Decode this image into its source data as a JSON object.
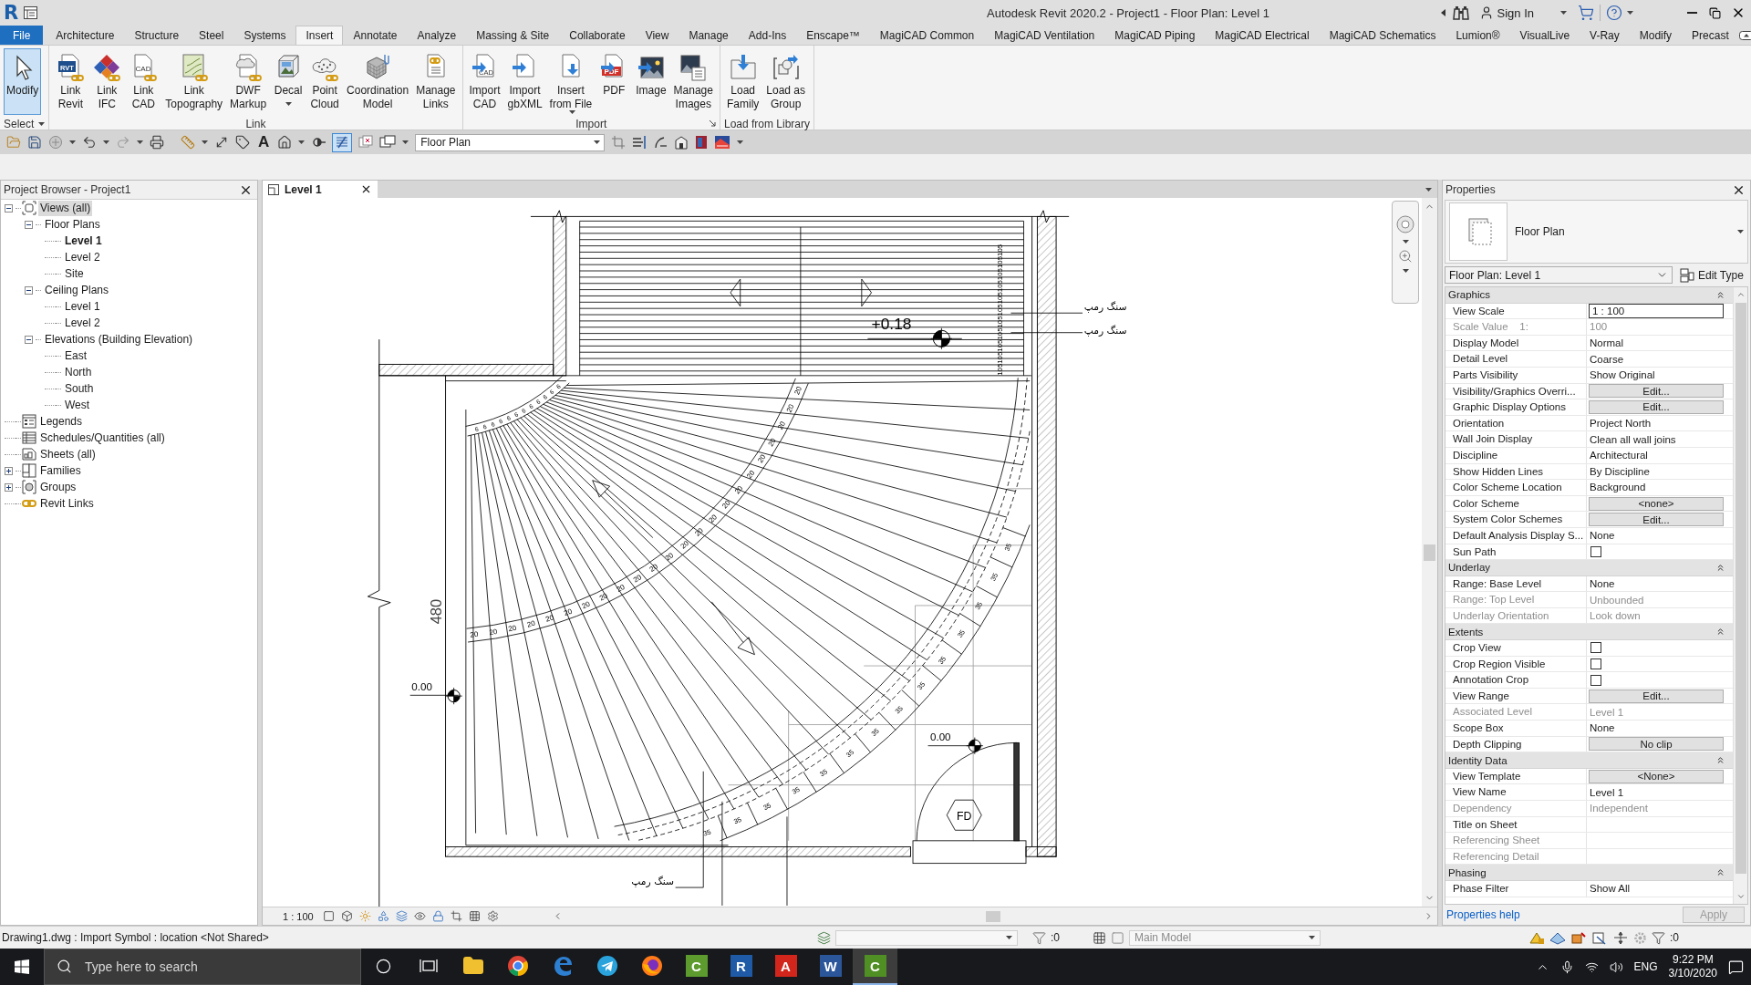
{
  "window": {
    "logo": "R",
    "title": "Autodesk Revit 2020.2 - Project1 - Floor Plan: Level 1",
    "sign_in": "Sign In"
  },
  "ribbon_tabs": [
    {
      "label": "File",
      "kind": "file",
      "selected": false
    },
    {
      "label": "Architecture",
      "kind": "tab",
      "selected": false
    },
    {
      "label": "Structure",
      "kind": "tab",
      "selected": false
    },
    {
      "label": "Steel",
      "kind": "tab",
      "selected": false
    },
    {
      "label": "Systems",
      "kind": "tab",
      "selected": false
    },
    {
      "label": "Insert",
      "kind": "tab",
      "selected": true
    },
    {
      "label": "Annotate",
      "kind": "tab",
      "selected": false
    },
    {
      "label": "Analyze",
      "kind": "tab",
      "selected": false
    },
    {
      "label": "Massing & Site",
      "kind": "tab",
      "selected": false
    },
    {
      "label": "Collaborate",
      "kind": "tab",
      "selected": false
    },
    {
      "label": "View",
      "kind": "tab",
      "selected": false
    },
    {
      "label": "Manage",
      "kind": "tab",
      "selected": false
    },
    {
      "label": "Add-Ins",
      "kind": "tab",
      "selected": false
    },
    {
      "label": "Enscape™",
      "kind": "tab",
      "selected": false
    },
    {
      "label": "MagiCAD Common",
      "kind": "tab",
      "selected": false
    },
    {
      "label": "MagiCAD Ventilation",
      "kind": "tab",
      "selected": false
    },
    {
      "label": "MagiCAD Piping",
      "kind": "tab",
      "selected": false
    },
    {
      "label": "MagiCAD Electrical",
      "kind": "tab",
      "selected": false
    },
    {
      "label": "MagiCAD Schematics",
      "kind": "tab",
      "selected": false
    },
    {
      "label": "Lumion®",
      "kind": "tab",
      "selected": false
    },
    {
      "label": "VisualLive",
      "kind": "tab",
      "selected": false
    },
    {
      "label": "V-Ray",
      "kind": "tab",
      "selected": false
    },
    {
      "label": "Modify",
      "kind": "tab",
      "selected": false
    },
    {
      "label": "Precast",
      "kind": "tab",
      "selected": false
    }
  ],
  "ribbon_panels": [
    {
      "title": "Select",
      "has_menu": true,
      "launcher": false,
      "buttons": [
        {
          "kind": "modify",
          "lines": [
            "Modify"
          ],
          "selected": true,
          "has_menu": false
        }
      ]
    },
    {
      "title": "Link",
      "has_menu": false,
      "launcher": false,
      "buttons": [
        {
          "kind": "revit",
          "lines": [
            "Link",
            "Revit"
          ],
          "icon_text": "RVT",
          "selected": false,
          "has_menu": false
        },
        {
          "kind": "ifc",
          "lines": [
            "Link",
            "IFC"
          ],
          "selected": false,
          "has_menu": false
        },
        {
          "kind": "cad",
          "lines": [
            "Link",
            "CAD"
          ],
          "icon_text": "CAD",
          "selected": false,
          "has_menu": false
        },
        {
          "kind": "topography",
          "lines": [
            "Link",
            "Topography"
          ],
          "selected": false,
          "has_menu": false
        },
        {
          "kind": "dwf",
          "lines": [
            "DWF",
            "Markup"
          ],
          "selected": false,
          "has_menu": false
        },
        {
          "kind": "decal",
          "lines": [
            "Decal"
          ],
          "selected": false,
          "has_menu": true
        },
        {
          "kind": "cloud",
          "lines": [
            "Point",
            "Cloud"
          ],
          "selected": false,
          "has_menu": false
        },
        {
          "kind": "coordination",
          "lines": [
            "Coordination",
            "Model"
          ],
          "selected": false,
          "has_menu": false
        },
        {
          "kind": "links",
          "lines": [
            "Manage",
            "Links"
          ],
          "selected": false,
          "has_menu": false
        }
      ]
    },
    {
      "title": "Import",
      "has_menu": false,
      "launcher": true,
      "buttons": [
        {
          "kind": "importcad",
          "lines": [
            "Import",
            "CAD"
          ],
          "icon_text": "CAD",
          "selected": false,
          "has_menu": false
        },
        {
          "kind": "gbxml",
          "lines": [
            "Import",
            "gbXML"
          ],
          "selected": false,
          "has_menu": false
        },
        {
          "kind": "insertfile",
          "lines": [
            "Insert",
            "from File"
          ],
          "selected": false,
          "has_menu": true
        },
        {
          "kind": "pdf",
          "lines": [
            "PDF"
          ],
          "icon_text": "PDF",
          "selected": false,
          "has_menu": false
        },
        {
          "kind": "image",
          "lines": [
            "Image"
          ],
          "selected": false,
          "has_menu": false
        },
        {
          "kind": "manageimages",
          "lines": [
            "Manage",
            "Images"
          ],
          "selected": false,
          "has_menu": false
        }
      ]
    },
    {
      "title": "Load from Library",
      "has_menu": false,
      "launcher": false,
      "buttons": [
        {
          "kind": "loadfamily",
          "lines": [
            "Load",
            "Family"
          ],
          "selected": false,
          "has_menu": false
        },
        {
          "kind": "loadgroup",
          "lines": [
            "Load as",
            "Group"
          ],
          "selected": false,
          "has_menu": false
        }
      ]
    }
  ],
  "quick_access": {
    "text_tool": "A",
    "thin_lines_on": true,
    "view": "Floor Plan"
  },
  "project_browser": {
    "title": "Project Browser - Project1",
    "tree": [
      {
        "label": "Views (all)",
        "kind": "views",
        "expanded": true,
        "selected": true,
        "children": [
          {
            "label": "Floor Plans",
            "expanded": true,
            "selected": false,
            "children": [
              {
                "label": "Level 1",
                "current": true,
                "selected": false
              },
              {
                "label": "Level 2",
                "current": false,
                "selected": false
              },
              {
                "label": "Site",
                "current": false,
                "selected": false
              }
            ]
          },
          {
            "label": "Ceiling Plans",
            "expanded": true,
            "selected": false,
            "children": [
              {
                "label": "Level 1",
                "current": false,
                "selected": false
              },
              {
                "label": "Level 2",
                "current": false,
                "selected": false
              }
            ]
          },
          {
            "label": "Elevations (Building Elevation)",
            "expanded": true,
            "selected": false,
            "children": [
              {
                "label": "East",
                "current": false,
                "selected": false
              },
              {
                "label": "North",
                "current": false,
                "selected": false
              },
              {
                "label": "South",
                "current": false,
                "selected": false
              },
              {
                "label": "West",
                "current": false,
                "selected": false
              }
            ]
          }
        ]
      },
      {
        "label": "Legends",
        "kind": "legends",
        "selected": false
      },
      {
        "label": "Schedules/Quantities (all)",
        "kind": "schedules",
        "selected": false
      },
      {
        "label": "Sheets (all)",
        "kind": "sheets",
        "selected": false
      },
      {
        "label": "Families",
        "kind": "families",
        "expanded": false,
        "selected": false
      },
      {
        "label": "Groups",
        "kind": "groups",
        "expanded": false,
        "selected": false
      },
      {
        "label": "Revit Links",
        "kind": "links",
        "selected": false
      }
    ]
  },
  "view": {
    "tab": "Level 1",
    "scale": "1 : 100"
  },
  "drawing": {
    "landing_label": "105105105105105105105105105105105",
    "levels": [
      "+0.18",
      "0.00",
      "0.00"
    ],
    "dimension": "480",
    "notes": [
      "سنگ رمپ",
      "سنگ رمپ",
      "سنگ رمپ"
    ],
    "tag": "FD",
    "inner_labels": [
      "6",
      "6",
      "6",
      "6",
      "6",
      "6",
      "6",
      "6",
      "6",
      "6",
      "6",
      "6"
    ],
    "middle_labels": [
      "20",
      "20",
      "20",
      "20",
      "20",
      "20",
      "20",
      "20",
      "20",
      "20",
      "20",
      "20",
      "20",
      "20",
      "20",
      "20",
      "20",
      "20",
      "20",
      "20",
      "20",
      "20",
      "20"
    ],
    "outer_labels": [
      "35",
      "35",
      "35",
      "35",
      "35",
      "35",
      "35",
      "35",
      "35",
      "35",
      "35",
      "35",
      "35",
      "35"
    ]
  },
  "properties": {
    "title": "Properties",
    "type_name": "Floor Plan",
    "instance": "Floor Plan: Level 1",
    "edit_type": "Edit Type",
    "groups": [
      {
        "name": "Graphics",
        "expanded": true,
        "rows": [
          {
            "label": "View Scale",
            "kind": "input",
            "value": "1 : 100",
            "disabled": false
          },
          {
            "label": "Scale Value    1:",
            "kind": "text",
            "value": "100",
            "disabled": true
          },
          {
            "label": "Display Model",
            "kind": "text",
            "value": "Normal",
            "disabled": false
          },
          {
            "label": "Detail Level",
            "kind": "text",
            "value": "Coarse",
            "disabled": false
          },
          {
            "label": "Parts Visibility",
            "kind": "text",
            "value": "Show Original",
            "disabled": false
          },
          {
            "label": "Visibility/Graphics Overri...",
            "kind": "button",
            "value": "Edit...",
            "disabled": false
          },
          {
            "label": "Graphic Display Options",
            "kind": "button",
            "value": "Edit...",
            "disabled": false
          },
          {
            "label": "Orientation",
            "kind": "text",
            "value": "Project North",
            "disabled": false
          },
          {
            "label": "Wall Join Display",
            "kind": "text",
            "value": "Clean all wall joins",
            "disabled": false
          },
          {
            "label": "Discipline",
            "kind": "text",
            "value": "Architectural",
            "disabled": false
          },
          {
            "label": "Show Hidden Lines",
            "kind": "text",
            "value": "By Discipline",
            "disabled": false
          },
          {
            "label": "Color Scheme Location",
            "kind": "text",
            "value": "Background",
            "disabled": false
          },
          {
            "label": "Color Scheme",
            "kind": "button",
            "value": "<none>",
            "disabled": false
          },
          {
            "label": "System Color Schemes",
            "kind": "button",
            "value": "Edit...",
            "disabled": false
          },
          {
            "label": "Default Analysis Display S...",
            "kind": "text",
            "value": "None",
            "disabled": false
          },
          {
            "label": "Sun Path",
            "kind": "checkbox",
            "checked": false,
            "disabled": false
          }
        ]
      },
      {
        "name": "Underlay",
        "expanded": true,
        "rows": [
          {
            "label": "Range: Base Level",
            "kind": "text",
            "value": "None",
            "disabled": false
          },
          {
            "label": "Range: Top Level",
            "kind": "text",
            "value": "Unbounded",
            "disabled": true
          },
          {
            "label": "Underlay Orientation",
            "kind": "text",
            "value": "Look down",
            "disabled": true
          }
        ]
      },
      {
        "name": "Extents",
        "expanded": true,
        "rows": [
          {
            "label": "Crop View",
            "kind": "checkbox",
            "checked": false,
            "disabled": false
          },
          {
            "label": "Crop Region Visible",
            "kind": "checkbox",
            "checked": false,
            "disabled": false
          },
          {
            "label": "Annotation Crop",
            "kind": "checkbox",
            "checked": false,
            "disabled": false
          },
          {
            "label": "View Range",
            "kind": "button",
            "value": "Edit...",
            "disabled": false
          },
          {
            "label": "Associated Level",
            "kind": "text",
            "value": "Level 1",
            "disabled": true
          },
          {
            "label": "Scope Box",
            "kind": "text",
            "value": "None",
            "disabled": false
          },
          {
            "label": "Depth Clipping",
            "kind": "button",
            "value": "No clip",
            "disabled": false
          }
        ]
      },
      {
        "name": "Identity Data",
        "expanded": true,
        "rows": [
          {
            "label": "View Template",
            "kind": "button",
            "value": "<None>",
            "disabled": false
          },
          {
            "label": "View Name",
            "kind": "text",
            "value": "Level 1",
            "disabled": false
          },
          {
            "label": "Dependency",
            "kind": "text",
            "value": "Independent",
            "disabled": true
          },
          {
            "label": "Title on Sheet",
            "kind": "text",
            "disabled": false
          },
          {
            "label": "Referencing Sheet",
            "kind": "text",
            "disabled": true
          },
          {
            "label": "Referencing Detail",
            "kind": "text",
            "disabled": true
          }
        ]
      },
      {
        "name": "Phasing",
        "expanded": true,
        "rows": [
          {
            "label": "Phase Filter",
            "kind": "text",
            "value": "Show All",
            "disabled": false
          }
        ]
      }
    ],
    "help": "Properties help",
    "apply": "Apply",
    "apply_disabled": true
  },
  "status_bar": {
    "message": "Drawing1.dwg : Import Symbol : location <Not Shared>",
    "editable_count": ":0",
    "model": "Main Model",
    "filter_count": ":0"
  },
  "taskbar": {
    "search_placeholder": "Type here to search",
    "apps": [
      {
        "kind": "explorer",
        "selected": false
      },
      {
        "kind": "chrome",
        "selected": false
      },
      {
        "kind": "edge",
        "selected": false
      },
      {
        "kind": "telegram",
        "selected": false
      },
      {
        "kind": "firefox",
        "selected": false
      },
      {
        "kind": "letter",
        "glyph": "C",
        "color": "#5d9b2f",
        "selected": false
      },
      {
        "kind": "letter",
        "glyph": "R",
        "color": "#1f5aa6",
        "selected": false
      },
      {
        "kind": "letter",
        "glyph": "A",
        "color": "#d2261c",
        "selected": false
      },
      {
        "kind": "letter",
        "glyph": "W",
        "color": "#2b579a",
        "selected": false
      },
      {
        "kind": "letter",
        "glyph": "C",
        "color": "#4f8f24",
        "selected": true
      }
    ],
    "language": "ENG",
    "time": "9:22 PM",
    "date": "3/10/2020"
  }
}
